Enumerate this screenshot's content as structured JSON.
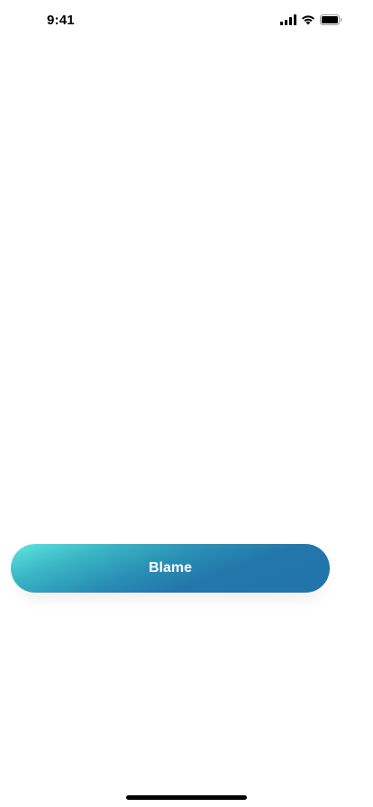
{
  "status_bar": {
    "time": "9:41",
    "icons": [
      "cellular-signal-icon",
      "wifi-icon",
      "battery-icon"
    ]
  },
  "main": {
    "button_label": "Blame"
  },
  "colors": {
    "button_gradient_start": "#5ee7e2",
    "button_gradient_end": "#2274a9",
    "button_text": "#ffffff",
    "background": "#ffffff"
  }
}
